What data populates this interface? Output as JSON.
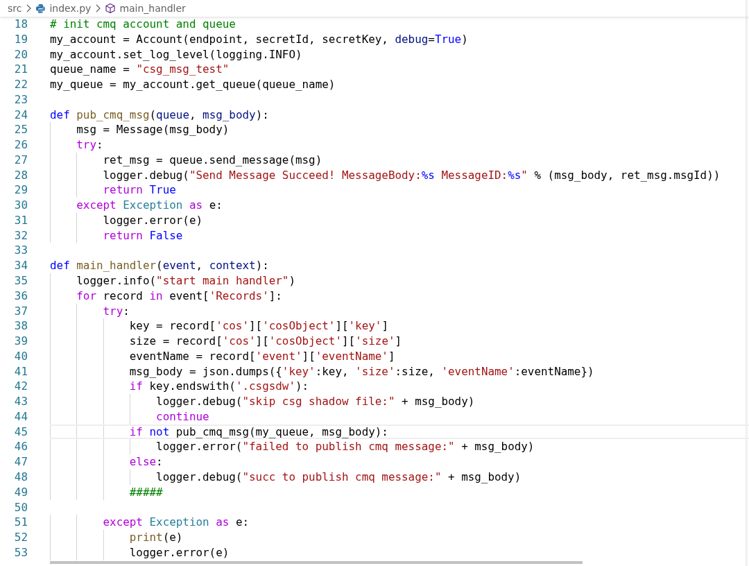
{
  "breadcrumb": [
    {
      "kind": "folder",
      "label": "src"
    },
    {
      "kind": "file",
      "label": "index.py"
    },
    {
      "kind": "symbol",
      "label": "main_handler"
    }
  ],
  "lines": [
    {
      "number": "18",
      "current": false,
      "tokens": [
        {
          "kind": "comment",
          "text": "# init cmq account and queue"
        }
      ]
    },
    {
      "number": "19",
      "current": false,
      "tokens": [
        {
          "kind": "plain",
          "text": "my_account = Account(endpoint, secretId, secretKey, "
        },
        {
          "kind": "param",
          "text": "debug"
        },
        {
          "kind": "plain",
          "text": "="
        },
        {
          "kind": "keyword",
          "text": "True"
        },
        {
          "kind": "plain",
          "text": ")"
        }
      ]
    },
    {
      "number": "20",
      "current": false,
      "tokens": [
        {
          "kind": "plain",
          "text": "my_account.set_log_level(logging.INFO)"
        }
      ]
    },
    {
      "number": "21",
      "current": false,
      "tokens": [
        {
          "kind": "plain",
          "text": "queue_name = "
        },
        {
          "kind": "string",
          "text": "\"csg_msg_test\""
        }
      ]
    },
    {
      "number": "22",
      "current": false,
      "tokens": [
        {
          "kind": "plain",
          "text": "my_queue = my_account.get_queue(queue_name)"
        }
      ]
    },
    {
      "number": "23",
      "current": false
    },
    {
      "number": "24",
      "current": false,
      "tokens": [
        {
          "kind": "keyword",
          "text": "def "
        },
        {
          "kind": "function",
          "text": "pub_cmq_msg"
        },
        {
          "kind": "plain",
          "text": "("
        },
        {
          "kind": "param",
          "text": "queue"
        },
        {
          "kind": "plain",
          "text": ", "
        },
        {
          "kind": "param",
          "text": "msg_body"
        },
        {
          "kind": "plain",
          "text": "):"
        }
      ]
    },
    {
      "number": "25",
      "current": false,
      "tokens": [
        {
          "kind": "plain",
          "text": "    msg = Message(msg_body)"
        }
      ]
    },
    {
      "number": "26",
      "current": false,
      "tokens": [
        {
          "kind": "control",
          "text": "    try"
        },
        {
          "kind": "plain",
          "text": ":"
        }
      ]
    },
    {
      "number": "27",
      "current": false,
      "tokens": [
        {
          "kind": "plain",
          "text": "        ret_msg = queue.send_message(msg)"
        }
      ]
    },
    {
      "number": "28",
      "current": false,
      "tokens": [
        {
          "kind": "plain",
          "text": "        logger.debug("
        },
        {
          "kind": "string",
          "text": "\"Send Message Succeed! MessageBody:"
        },
        {
          "kind": "format",
          "text": "%s"
        },
        {
          "kind": "string",
          "text": " MessageID:"
        },
        {
          "kind": "format",
          "text": "%s"
        },
        {
          "kind": "string",
          "text": "\""
        },
        {
          "kind": "plain",
          "text": " % (msg_body, ret_msg.msgId))"
        }
      ]
    },
    {
      "number": "29",
      "current": false,
      "tokens": [
        {
          "kind": "control",
          "text": "        return "
        },
        {
          "kind": "keyword",
          "text": "True"
        }
      ]
    },
    {
      "number": "30",
      "current": false,
      "tokens": [
        {
          "kind": "control",
          "text": "    except "
        },
        {
          "kind": "type",
          "text": "Exception "
        },
        {
          "kind": "control",
          "text": "as"
        },
        {
          "kind": "plain",
          "text": " e:"
        }
      ]
    },
    {
      "number": "31",
      "current": false,
      "tokens": [
        {
          "kind": "plain",
          "text": "        logger.error(e)"
        }
      ]
    },
    {
      "number": "32",
      "current": false,
      "tokens": [
        {
          "kind": "control",
          "text": "        return "
        },
        {
          "kind": "keyword",
          "text": "False"
        }
      ]
    },
    {
      "number": "33",
      "current": false
    },
    {
      "number": "34",
      "current": false,
      "tokens": [
        {
          "kind": "keyword",
          "text": "def "
        },
        {
          "kind": "function",
          "text": "main_handler"
        },
        {
          "kind": "plain",
          "text": "("
        },
        {
          "kind": "param",
          "text": "event"
        },
        {
          "kind": "plain",
          "text": ", "
        },
        {
          "kind": "param",
          "text": "context"
        },
        {
          "kind": "plain",
          "text": "):"
        }
      ]
    },
    {
      "number": "35",
      "current": false,
      "tokens": [
        {
          "kind": "plain",
          "text": "    logger.info("
        },
        {
          "kind": "string",
          "text": "\"start main handler\""
        },
        {
          "kind": "plain",
          "text": ")"
        }
      ]
    },
    {
      "number": "36",
      "current": false,
      "tokens": [
        {
          "kind": "control",
          "text": "    for"
        },
        {
          "kind": "plain",
          "text": " record "
        },
        {
          "kind": "control",
          "text": "in"
        },
        {
          "kind": "plain",
          "text": " event["
        },
        {
          "kind": "string",
          "text": "'Records'"
        },
        {
          "kind": "plain",
          "text": "]:"
        }
      ]
    },
    {
      "number": "37",
      "current": false,
      "tokens": [
        {
          "kind": "control",
          "text": "        try"
        },
        {
          "kind": "plain",
          "text": ":"
        }
      ]
    },
    {
      "number": "38",
      "current": false,
      "tokens": [
        {
          "kind": "plain",
          "text": "            key = record["
        },
        {
          "kind": "string",
          "text": "'cos'"
        },
        {
          "kind": "plain",
          "text": "]["
        },
        {
          "kind": "string",
          "text": "'cosObject'"
        },
        {
          "kind": "plain",
          "text": "]["
        },
        {
          "kind": "string",
          "text": "'key'"
        },
        {
          "kind": "plain",
          "text": "]"
        }
      ]
    },
    {
      "number": "39",
      "current": false,
      "tokens": [
        {
          "kind": "plain",
          "text": "            size = record["
        },
        {
          "kind": "string",
          "text": "'cos'"
        },
        {
          "kind": "plain",
          "text": "]["
        },
        {
          "kind": "string",
          "text": "'cosObject'"
        },
        {
          "kind": "plain",
          "text": "]["
        },
        {
          "kind": "string",
          "text": "'size'"
        },
        {
          "kind": "plain",
          "text": "]"
        }
      ]
    },
    {
      "number": "40",
      "current": false,
      "tokens": [
        {
          "kind": "plain",
          "text": "            eventName = record["
        },
        {
          "kind": "string",
          "text": "'event'"
        },
        {
          "kind": "plain",
          "text": "]["
        },
        {
          "kind": "string",
          "text": "'eventName'"
        },
        {
          "kind": "plain",
          "text": "]"
        }
      ]
    },
    {
      "number": "41",
      "current": false,
      "tokens": [
        {
          "kind": "plain",
          "text": "            msg_body = json.dumps({"
        },
        {
          "kind": "string",
          "text": "'key'"
        },
        {
          "kind": "plain",
          "text": ":key, "
        },
        {
          "kind": "string",
          "text": "'size'"
        },
        {
          "kind": "plain",
          "text": ":size, "
        },
        {
          "kind": "string",
          "text": "'eventName'"
        },
        {
          "kind": "plain",
          "text": ":eventName})"
        }
      ]
    },
    {
      "number": "42",
      "current": false,
      "tokens": [
        {
          "kind": "control",
          "text": "            if"
        },
        {
          "kind": "plain",
          "text": " key.endswith("
        },
        {
          "kind": "string",
          "text": "'.csgsdw'"
        },
        {
          "kind": "plain",
          "text": "):"
        }
      ]
    },
    {
      "number": "43",
      "current": false,
      "tokens": [
        {
          "kind": "plain",
          "text": "                logger.debug("
        },
        {
          "kind": "string",
          "text": "\"skip csg shadow file:\""
        },
        {
          "kind": "plain",
          "text": " + msg_body)"
        }
      ]
    },
    {
      "number": "44",
      "current": false,
      "tokens": [
        {
          "kind": "control",
          "text": "                continue"
        }
      ]
    },
    {
      "number": "45",
      "current": true,
      "tokens": [
        {
          "kind": "control",
          "text": "            if "
        },
        {
          "kind": "keyword",
          "text": "not"
        },
        {
          "kind": "plain",
          "text": " pub_cmq_msg(my_queue, msg_body):"
        }
      ]
    },
    {
      "number": "46",
      "current": false,
      "tokens": [
        {
          "kind": "plain",
          "text": "                logger.error("
        },
        {
          "kind": "string",
          "text": "\"failed to publish cmq message:\""
        },
        {
          "kind": "plain",
          "text": " + msg_body)"
        }
      ]
    },
    {
      "number": "47",
      "current": false,
      "tokens": [
        {
          "kind": "control",
          "text": "            else"
        },
        {
          "kind": "plain",
          "text": ":"
        }
      ]
    },
    {
      "number": "48",
      "current": false,
      "tokens": [
        {
          "kind": "plain",
          "text": "                logger.debug("
        },
        {
          "kind": "string",
          "text": "\"succ to publish cmq message:\""
        },
        {
          "kind": "plain",
          "text": " + msg_body)"
        }
      ]
    },
    {
      "number": "49",
      "current": false,
      "tokens": [
        {
          "kind": "comment",
          "text": "            #####"
        }
      ]
    },
    {
      "number": "50",
      "current": false
    },
    {
      "number": "51",
      "current": false,
      "tokens": [
        {
          "kind": "control",
          "text": "        except "
        },
        {
          "kind": "type",
          "text": "Exception "
        },
        {
          "kind": "control",
          "text": "as"
        },
        {
          "kind": "plain",
          "text": " e:"
        }
      ]
    },
    {
      "number": "52",
      "current": false,
      "tokens": [
        {
          "kind": "function",
          "text": "            print"
        },
        {
          "kind": "plain",
          "text": "(e)"
        }
      ]
    },
    {
      "number": "53",
      "current": false,
      "tokens": [
        {
          "kind": "plain",
          "text": "            logger.error(e)"
        }
      ]
    }
  ]
}
